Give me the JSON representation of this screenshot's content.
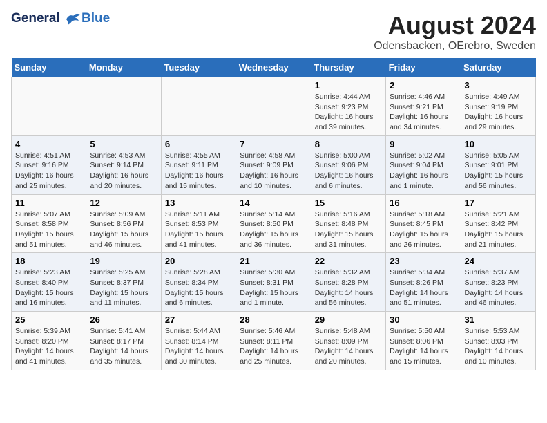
{
  "logo": {
    "line1": "General",
    "line2": "Blue"
  },
  "title": "August 2024",
  "subtitle": "Odensbacken, OErebro, Sweden",
  "days_header": [
    "Sunday",
    "Monday",
    "Tuesday",
    "Wednesday",
    "Thursday",
    "Friday",
    "Saturday"
  ],
  "weeks": [
    [
      {
        "day": "",
        "detail": ""
      },
      {
        "day": "",
        "detail": ""
      },
      {
        "day": "",
        "detail": ""
      },
      {
        "day": "",
        "detail": ""
      },
      {
        "day": "1",
        "detail": "Sunrise: 4:44 AM\nSunset: 9:23 PM\nDaylight: 16 hours\nand 39 minutes."
      },
      {
        "day": "2",
        "detail": "Sunrise: 4:46 AM\nSunset: 9:21 PM\nDaylight: 16 hours\nand 34 minutes."
      },
      {
        "day": "3",
        "detail": "Sunrise: 4:49 AM\nSunset: 9:19 PM\nDaylight: 16 hours\nand 29 minutes."
      }
    ],
    [
      {
        "day": "4",
        "detail": "Sunrise: 4:51 AM\nSunset: 9:16 PM\nDaylight: 16 hours\nand 25 minutes."
      },
      {
        "day": "5",
        "detail": "Sunrise: 4:53 AM\nSunset: 9:14 PM\nDaylight: 16 hours\nand 20 minutes."
      },
      {
        "day": "6",
        "detail": "Sunrise: 4:55 AM\nSunset: 9:11 PM\nDaylight: 16 hours\nand 15 minutes."
      },
      {
        "day": "7",
        "detail": "Sunrise: 4:58 AM\nSunset: 9:09 PM\nDaylight: 16 hours\nand 10 minutes."
      },
      {
        "day": "8",
        "detail": "Sunrise: 5:00 AM\nSunset: 9:06 PM\nDaylight: 16 hours\nand 6 minutes."
      },
      {
        "day": "9",
        "detail": "Sunrise: 5:02 AM\nSunset: 9:04 PM\nDaylight: 16 hours\nand 1 minute."
      },
      {
        "day": "10",
        "detail": "Sunrise: 5:05 AM\nSunset: 9:01 PM\nDaylight: 15 hours\nand 56 minutes."
      }
    ],
    [
      {
        "day": "11",
        "detail": "Sunrise: 5:07 AM\nSunset: 8:58 PM\nDaylight: 15 hours\nand 51 minutes."
      },
      {
        "day": "12",
        "detail": "Sunrise: 5:09 AM\nSunset: 8:56 PM\nDaylight: 15 hours\nand 46 minutes."
      },
      {
        "day": "13",
        "detail": "Sunrise: 5:11 AM\nSunset: 8:53 PM\nDaylight: 15 hours\nand 41 minutes."
      },
      {
        "day": "14",
        "detail": "Sunrise: 5:14 AM\nSunset: 8:50 PM\nDaylight: 15 hours\nand 36 minutes."
      },
      {
        "day": "15",
        "detail": "Sunrise: 5:16 AM\nSunset: 8:48 PM\nDaylight: 15 hours\nand 31 minutes."
      },
      {
        "day": "16",
        "detail": "Sunrise: 5:18 AM\nSunset: 8:45 PM\nDaylight: 15 hours\nand 26 minutes."
      },
      {
        "day": "17",
        "detail": "Sunrise: 5:21 AM\nSunset: 8:42 PM\nDaylight: 15 hours\nand 21 minutes."
      }
    ],
    [
      {
        "day": "18",
        "detail": "Sunrise: 5:23 AM\nSunset: 8:40 PM\nDaylight: 15 hours\nand 16 minutes."
      },
      {
        "day": "19",
        "detail": "Sunrise: 5:25 AM\nSunset: 8:37 PM\nDaylight: 15 hours\nand 11 minutes."
      },
      {
        "day": "20",
        "detail": "Sunrise: 5:28 AM\nSunset: 8:34 PM\nDaylight: 15 hours\nand 6 minutes."
      },
      {
        "day": "21",
        "detail": "Sunrise: 5:30 AM\nSunset: 8:31 PM\nDaylight: 15 hours\nand 1 minute."
      },
      {
        "day": "22",
        "detail": "Sunrise: 5:32 AM\nSunset: 8:28 PM\nDaylight: 14 hours\nand 56 minutes."
      },
      {
        "day": "23",
        "detail": "Sunrise: 5:34 AM\nSunset: 8:26 PM\nDaylight: 14 hours\nand 51 minutes."
      },
      {
        "day": "24",
        "detail": "Sunrise: 5:37 AM\nSunset: 8:23 PM\nDaylight: 14 hours\nand 46 minutes."
      }
    ],
    [
      {
        "day": "25",
        "detail": "Sunrise: 5:39 AM\nSunset: 8:20 PM\nDaylight: 14 hours\nand 41 minutes."
      },
      {
        "day": "26",
        "detail": "Sunrise: 5:41 AM\nSunset: 8:17 PM\nDaylight: 14 hours\nand 35 minutes."
      },
      {
        "day": "27",
        "detail": "Sunrise: 5:44 AM\nSunset: 8:14 PM\nDaylight: 14 hours\nand 30 minutes."
      },
      {
        "day": "28",
        "detail": "Sunrise: 5:46 AM\nSunset: 8:11 PM\nDaylight: 14 hours\nand 25 minutes."
      },
      {
        "day": "29",
        "detail": "Sunrise: 5:48 AM\nSunset: 8:09 PM\nDaylight: 14 hours\nand 20 minutes."
      },
      {
        "day": "30",
        "detail": "Sunrise: 5:50 AM\nSunset: 8:06 PM\nDaylight: 14 hours\nand 15 minutes."
      },
      {
        "day": "31",
        "detail": "Sunrise: 5:53 AM\nSunset: 8:03 PM\nDaylight: 14 hours\nand 10 minutes."
      }
    ]
  ]
}
